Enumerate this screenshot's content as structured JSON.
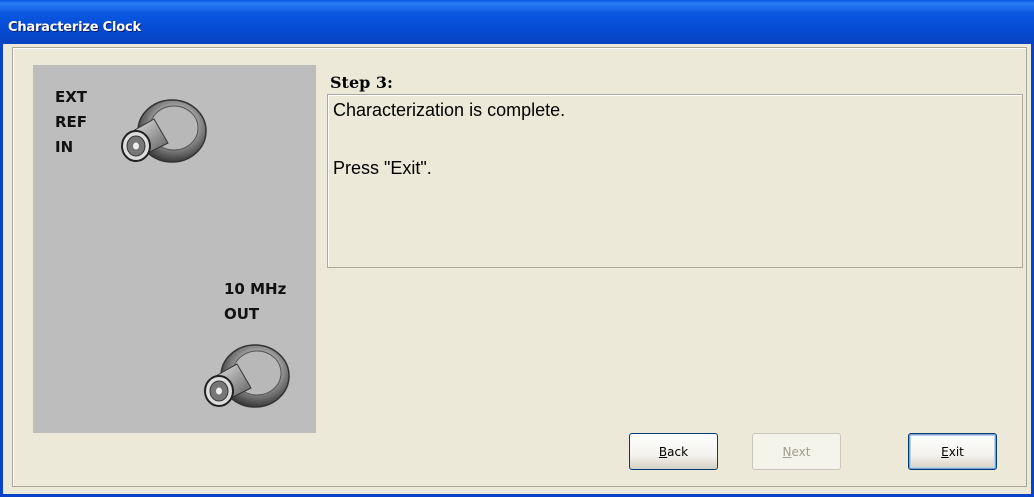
{
  "window": {
    "title": "Characterize Clock"
  },
  "panel": {
    "ext_ref_label": "EXT\nREF\nIN",
    "ten_mhz_label": "10 MHz\nOUT",
    "connector_icon": "bnc-connector-icon"
  },
  "step": {
    "title": "Step 3:",
    "line1": "Characterization is complete.",
    "line2": "Press \"Exit\"."
  },
  "buttons": {
    "back_mnemonic": "B",
    "back_rest": "ack",
    "next_mnemonic": "N",
    "next_rest": "ext",
    "exit_mnemonic": "E",
    "exit_rest": "xit",
    "next_enabled": false
  }
}
